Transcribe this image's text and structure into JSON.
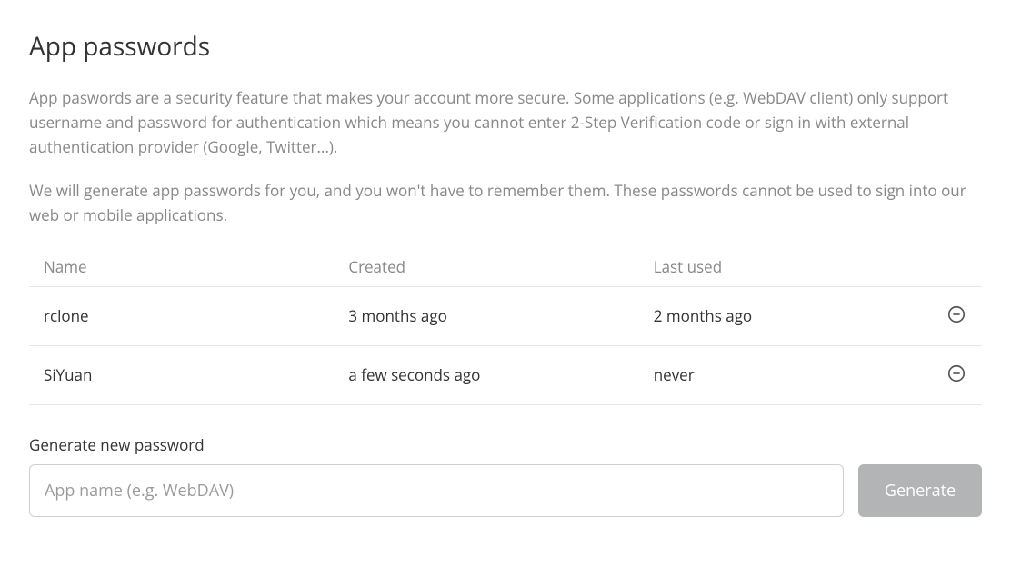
{
  "title": "App passwords",
  "description": {
    "p1": "App paswords are a security feature that makes your account more secure. Some applications (e.g. WebDAV client) only support username and password for authentication which means you cannot enter 2-Step Verification code or sign in with external authentication provider (Google, Twitter...).",
    "p2": "We will generate app passwords for you, and you won't have to remember them. These passwords cannot be used to sign into our web or mobile applications."
  },
  "table": {
    "headers": {
      "name": "Name",
      "created": "Created",
      "last_used": "Last used"
    },
    "rows": [
      {
        "name": "rclone",
        "created": "3 months ago",
        "last_used": "2 months ago"
      },
      {
        "name": "SiYuan",
        "created": "a few seconds ago",
        "last_used": "never"
      }
    ]
  },
  "new_password": {
    "label": "Generate new password",
    "placeholder": "App name (e.g. WebDAV)",
    "button": "Generate"
  }
}
